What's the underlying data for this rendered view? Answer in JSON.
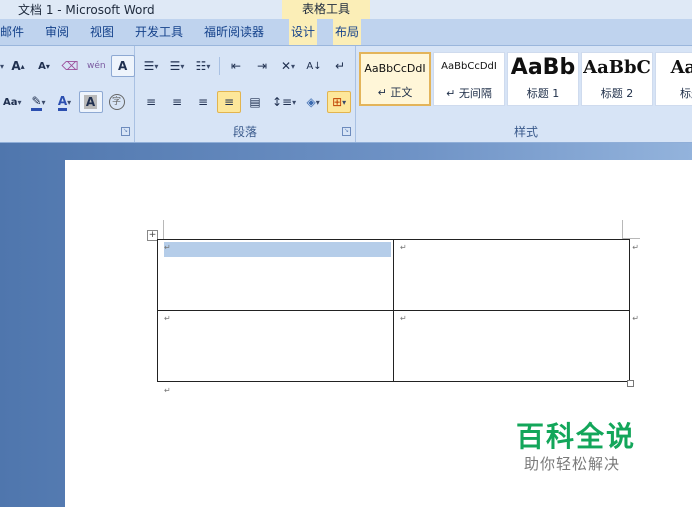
{
  "titlebar": {
    "title": "文档 1 - Microsoft Word",
    "context_title": "表格工具"
  },
  "tabs": [
    {
      "label": "邮件"
    },
    {
      "label": "审阅"
    },
    {
      "label": "视图"
    },
    {
      "label": "开发工具"
    },
    {
      "label": "福昕阅读器"
    },
    {
      "label": "设计"
    },
    {
      "label": "布局"
    }
  ],
  "ribbon": {
    "font_group": {
      "grow_font": "A",
      "shrink_font": "A",
      "phonetic": "wén",
      "char_border": "A",
      "change_case": "Aa",
      "font_color": "A",
      "char_shading": "A",
      "enclose_char": "字"
    },
    "paragraph_group": {
      "label": "段落"
    },
    "styles_group": {
      "label": "样式",
      "items": [
        {
          "sample": "AaBbCcDdI",
          "name": "↵ 正文"
        },
        {
          "sample": "AaBbCcDdI",
          "name": "↵ 无间隔"
        },
        {
          "sample": "AaBb",
          "name": "标题 1"
        },
        {
          "sample": "AaBbC",
          "name": "标题 2"
        },
        {
          "sample": "AaB",
          "name": "标题"
        }
      ]
    }
  },
  "document": {
    "table": {
      "rows": 2,
      "cols": 2
    },
    "paragraph_mark": "↵",
    "move_handle": "+"
  },
  "watermark": {
    "main": "百科全说",
    "sub": "助你轻松解决"
  },
  "colors": {
    "accent_yellow": "#fbeeb7",
    "ribbon": "#d7e4f6",
    "watermark_green": "#13a65a"
  }
}
